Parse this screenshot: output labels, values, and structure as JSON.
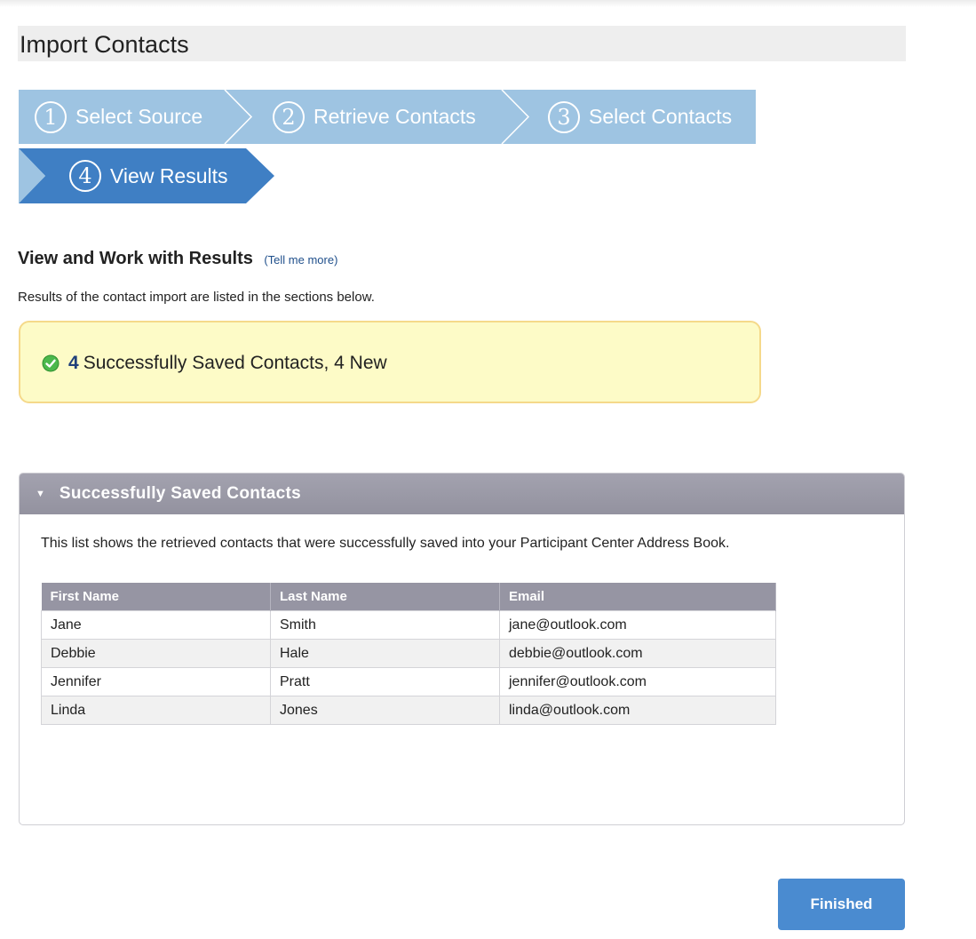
{
  "page": {
    "title": "Import Contacts"
  },
  "wizard": {
    "steps": [
      {
        "number": "1",
        "label": "Select Source",
        "state": "completed"
      },
      {
        "number": "2",
        "label": "Retrieve Contacts",
        "state": "completed"
      },
      {
        "number": "3",
        "label": "Select Contacts",
        "state": "completed"
      },
      {
        "number": "4",
        "label": "View Results",
        "state": "active"
      }
    ],
    "colors": {
      "inactive": "#9ec4e2",
      "active": "#3f7fc4"
    }
  },
  "results": {
    "heading": "View and Work with Results",
    "help_link": "(Tell me more)",
    "description": "Results of the contact import are listed in the sections below."
  },
  "status": {
    "icon": "check-circle-icon",
    "count": "4",
    "text": "Successfully Saved Contacts, 4 New"
  },
  "panel": {
    "title": "Successfully Saved Contacts",
    "description": "This list shows the retrieved contacts that were successfully saved into your Participant Center Address Book.",
    "columns": [
      "First Name",
      "Last Name",
      "Email"
    ],
    "rows": [
      [
        "Jane",
        "Smith",
        "jane@outlook.com"
      ],
      [
        "Debbie",
        "Hale",
        "debbie@outlook.com"
      ],
      [
        "Jennifer",
        "Pratt",
        "jennifer@outlook.com"
      ],
      [
        "Linda",
        "Jones",
        "linda@outlook.com"
      ]
    ]
  },
  "actions": {
    "finished_label": "Finished",
    "color": "#4a8bd0"
  }
}
